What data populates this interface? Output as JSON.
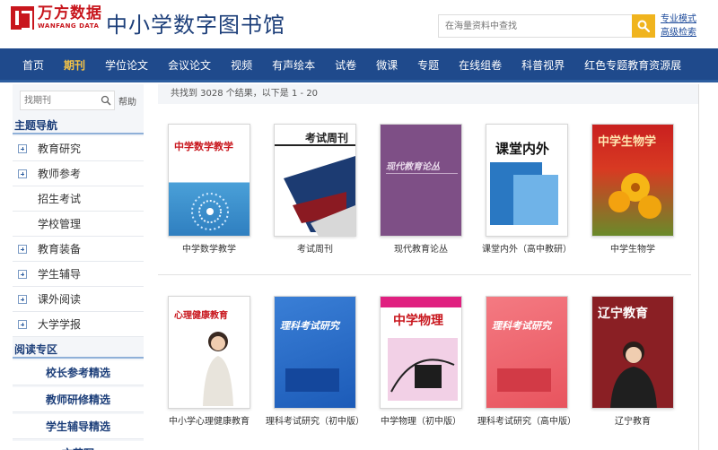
{
  "header": {
    "logo_cn": "万方数据",
    "logo_en": "WANFANG DATA",
    "site_title": "中小学数字图书馆",
    "search_placeholder": "在海量资料中查找",
    "links": [
      "专业模式",
      "高级检索"
    ]
  },
  "nav": {
    "items": [
      "首页",
      "期刊",
      "学位论文",
      "会议论文",
      "视频",
      "有声绘本",
      "试卷",
      "微课",
      "专题",
      "在线组卷",
      "科普视界",
      "红色专题教育资源展"
    ],
    "active_index": 1
  },
  "sidebar": {
    "search_placeholder": "找期刊",
    "help": "帮助",
    "topic_title": "主题导航",
    "topics": [
      {
        "label": "教育研究",
        "expandable": true
      },
      {
        "label": "教师参考",
        "expandable": true
      },
      {
        "label": "招生考试",
        "expandable": false
      },
      {
        "label": "学校管理",
        "expandable": false
      },
      {
        "label": "教育装备",
        "expandable": true
      },
      {
        "label": "学生辅导",
        "expandable": true
      },
      {
        "label": "课外阅读",
        "expandable": true
      },
      {
        "label": "大学学报",
        "expandable": true
      }
    ],
    "reading_title": "阅读专区",
    "reading_items": [
      "校长参考精选",
      "教师研修精选",
      "学生辅导精选",
      "文苑写"
    ]
  },
  "main": {
    "result_text": "共找到 3028 个结果，以下是 1 - 20",
    "journals": [
      {
        "title": "中学数学教学",
        "cover_text": "中学数学教学"
      },
      {
        "title": "考试周刊",
        "cover_text": "考试周刊"
      },
      {
        "title": "现代教育论丛",
        "cover_text": "现代教育论丛"
      },
      {
        "title": "课堂内外（高中教研）",
        "cover_text": "课堂内外"
      },
      {
        "title": "中学生物学",
        "cover_text": "中学生物学"
      },
      {
        "title": "中小学心理健康教育",
        "cover_text": "心理健康教育"
      },
      {
        "title": "理科考试研究（初中版）",
        "cover_text": "理科考试研究"
      },
      {
        "title": "中学物理（初中版）",
        "cover_text": "中学物理"
      },
      {
        "title": "理科考试研究（高中版）",
        "cover_text": "理科考试研究"
      },
      {
        "title": "辽宁教育",
        "cover_text": "辽宁教育"
      }
    ]
  },
  "colors": {
    "nav_bg": "#1f4a8c",
    "nav_active": "#f6c445",
    "brand_red": "#c8161d",
    "title_blue": "#1d3f7a",
    "search_button": "#f0b41e"
  }
}
